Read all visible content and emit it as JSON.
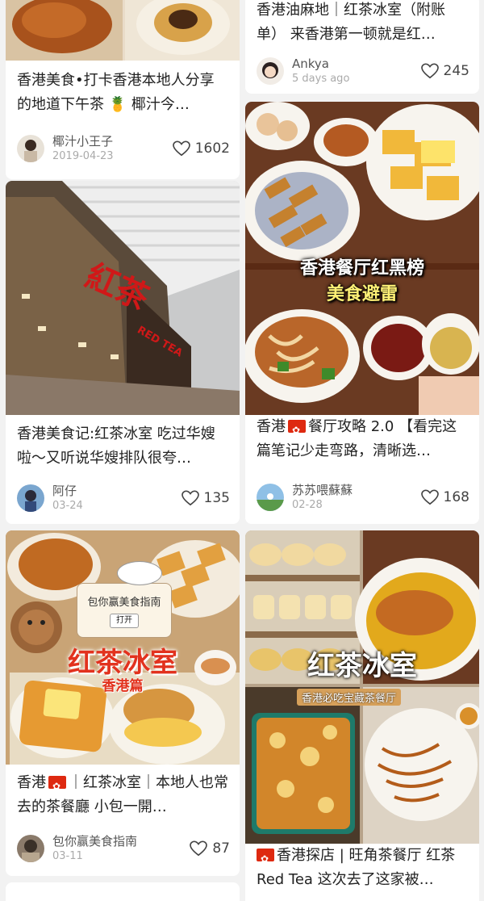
{
  "feed": {
    "left": [
      {
        "title": "香港美食•打卡香港本地人分享的地道下午茶 🍍 椰汁今…",
        "author": "椰汁小王子",
        "date": "2019-04-23",
        "likes": "1602"
      },
      {
        "title": "香港美食记:红茶冰室 吃过华嫂啦～又听说华嫂排队很夸…",
        "author": "阿仔",
        "date": "03-24",
        "likes": "135",
        "image_sign": "紅茶",
        "image_sign_en": "RED TEA"
      },
      {
        "title_prefix": "香港",
        "title_rest": "｜红茶冰室｜本地人也常去的茶餐廳 小包一開…",
        "author": "包你赢美食指南",
        "date": "03-11",
        "likes": "87",
        "image_banner": "包你赢美食指南",
        "image_button": "打开",
        "image_title": "红茶冰室",
        "image_subtitle": "香港篇"
      }
    ],
    "right": [
      {
        "title": "香港油麻地｜红茶冰室（附账单） 来香港第一顿就是红…",
        "author": "Ankya",
        "date": "5 days ago",
        "likes": "245"
      },
      {
        "title_prefix": "香港",
        "title_rest": "餐厅攻略 2.0 【看完这篇笔记少走弯路，清晰选…",
        "author": "苏苏喂蘇蘇",
        "date": "02-28",
        "likes": "168",
        "image_title": "香港餐厅红黑榜",
        "image_subtitle": "美食避雷"
      },
      {
        "title_prefix": "",
        "title_rest": "香港探店 | 旺角茶餐厅 红茶 Red Tea 这次去了这家被…",
        "image_title": "红茶冰室",
        "image_subtitle": "香港必吃宝藏茶餐厅"
      }
    ]
  },
  "colors": {
    "card_bg": "#ffffff",
    "page_bg": "#f2f2f2",
    "sign_red": "#d01818"
  }
}
